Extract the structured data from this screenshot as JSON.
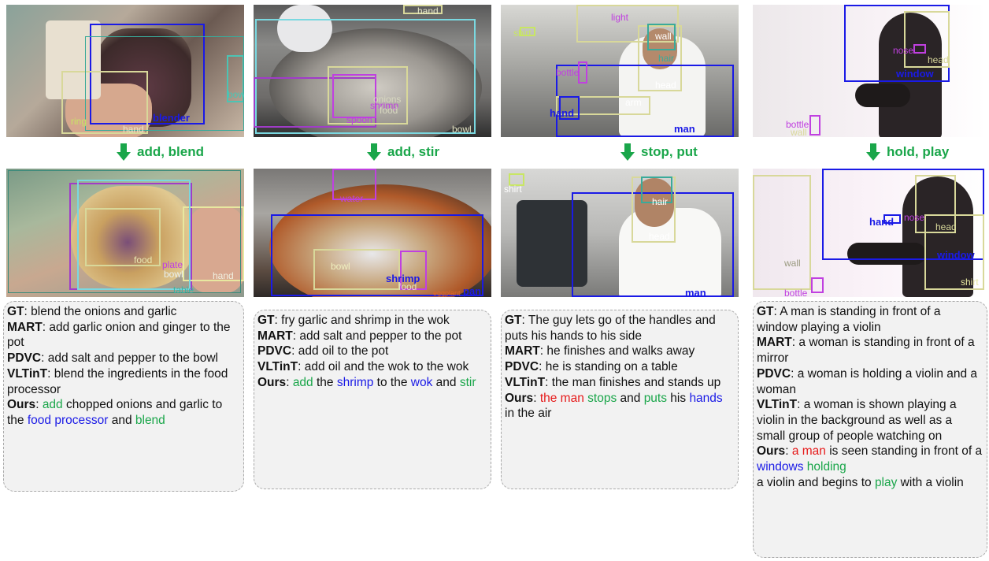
{
  "colors": {
    "verb_green": "#1aa64a",
    "object_blue": "#1a1ae6",
    "subject_red": "#e61a1a"
  },
  "columns": [
    {
      "verb": "add, blend",
      "top_labels": [
        "blender",
        "bowl",
        "ring",
        "hand"
      ],
      "bottom_labels": [
        "food",
        "plate",
        "bowl",
        "hand",
        "table"
      ],
      "caption": {
        "gt_key": "GT",
        "gt": "blend the onions and garlic",
        "mart_key": "MART",
        "mart": "add garlic onion and ginger to the pot",
        "pdvc_key": "PDVC",
        "pdvc": "add salt and pepper to the bowl",
        "vltint_key": "VLTinT",
        "vltint": "blend the ingredients in the food processor",
        "ours_key": "Ours",
        "ours": [
          {
            "t": "add",
            "c": "g"
          },
          {
            "t": " chopped onions and garlic to the ",
            "c": ""
          },
          {
            "t": "food processor",
            "c": "bl"
          },
          {
            "t": " and ",
            "c": ""
          },
          {
            "t": "blend",
            "c": "g"
          }
        ]
      }
    },
    {
      "verb": "add, stir",
      "top_labels": [
        "hand",
        "shrimp",
        "spoon",
        "bowl",
        "onions",
        "food"
      ],
      "bottom_labels": [
        "water",
        "bowl",
        "shrimp",
        "food",
        "pan",
        "eggplant"
      ],
      "caption": {
        "gt_key": "GT",
        "gt": "fry garlic and shrimp in the wok",
        "mart_key": "MART",
        "mart": "add salt and pepper to the pot",
        "pdvc_key": "PDVC",
        "pdvc": "add oil to the pot",
        "vltint_key": "VLTinT",
        "vltint": "add oil and the wok to the wok",
        "ours_key": "Ours",
        "ours": [
          {
            "t": "add",
            "c": "g"
          },
          {
            "t": " the ",
            "c": ""
          },
          {
            "t": "shrimp",
            "c": "bl"
          },
          {
            "t": " to the ",
            "c": ""
          },
          {
            "t": "wok",
            "c": "bl"
          },
          {
            "t": " and ",
            "c": ""
          },
          {
            "t": "stir",
            "c": "g"
          }
        ]
      }
    },
    {
      "verb": "stop, put",
      "top_labels": [
        "shirt",
        "light",
        "wall",
        "hair",
        "bottle",
        "head",
        "arm",
        "hand",
        "man"
      ],
      "bottom_labels": [
        "shirt",
        "hair",
        "head",
        "man"
      ],
      "caption": {
        "gt_key": "GT",
        "gt": "The guy lets go of the handles and puts his hands to his side",
        "mart_key": "MART",
        "mart": "he finishes and walks away",
        "pdvc_key": "PDVC",
        "pdvc": "he is standing on a table",
        "vltint_key": "VLTinT",
        "vltint": "the man finishes and stands up",
        "ours_key": "Ours",
        "ours": [
          {
            "t": "the man",
            "c": "r"
          },
          {
            "t": " ",
            "c": ""
          },
          {
            "t": "stops",
            "c": "g"
          },
          {
            "t": " and ",
            "c": ""
          },
          {
            "t": "puts",
            "c": "g"
          },
          {
            "t": " his ",
            "c": ""
          },
          {
            "t": "hands",
            "c": "bl"
          },
          {
            "t": " in the air",
            "c": ""
          }
        ]
      }
    },
    {
      "verb": "hold, play",
      "top_labels": [
        "nose",
        "head",
        "window",
        "bottle",
        "wall"
      ],
      "bottom_labels": [
        "hand",
        "nose",
        "head",
        "window",
        "wall",
        "shirt",
        "bottle"
      ],
      "caption": {
        "gt_key": "GT",
        "gt": "A man is standing in front of a window playing a violin",
        "mart_key": "MART",
        "mart": "a woman is standing in front of a mirror",
        "pdvc_key": "PDVC",
        "pdvc": "a woman is holding a violin and a woman",
        "vltint_key": "VLTinT",
        "vltint": "a woman is shown playing a violin in the background as well as a small group of people watching on",
        "ours_key": "Ours",
        "ours": [
          {
            "t": "a man",
            "c": "r"
          },
          {
            "t": " is seen standing in front of a ",
            "c": ""
          },
          {
            "t": "windows",
            "c": "bl"
          },
          {
            "t": " ",
            "c": ""
          },
          {
            "t": "holding",
            "c": "g"
          },
          {
            "t": "\n",
            "c": ""
          },
          {
            "t": "a violin and begins to ",
            "c": ""
          },
          {
            "t": "play",
            "c": "g"
          },
          {
            "t": " with a violin",
            "c": ""
          }
        ]
      }
    }
  ]
}
